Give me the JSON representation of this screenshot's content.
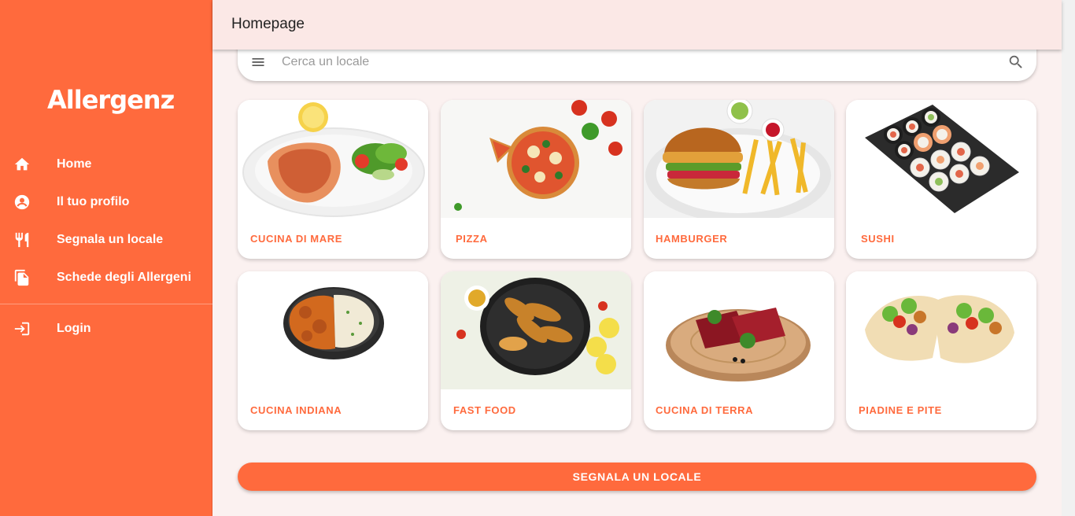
{
  "app": {
    "logo_text": "Allergenz"
  },
  "header": {
    "title": "Homepage"
  },
  "sidebar": {
    "items": [
      {
        "label": "Home",
        "icon": "home-icon"
      },
      {
        "label": "Il tuo profilo",
        "icon": "account-icon"
      },
      {
        "label": "Segnala un locale",
        "icon": "restaurant-icon"
      },
      {
        "label": "Schede degli Allergeni",
        "icon": "file-copy-icon"
      }
    ],
    "login": {
      "label": "Login",
      "icon": "login-icon"
    }
  },
  "search": {
    "placeholder": "Cerca un locale",
    "value": ""
  },
  "categories": [
    {
      "label": "CUCINA DI MARE",
      "image": "salmon-steak-plate"
    },
    {
      "label": "PIZZA",
      "image": "pizza"
    },
    {
      "label": "HAMBURGER",
      "image": "burger-and-fries"
    },
    {
      "label": "SUSHI",
      "image": "sushi-platter"
    },
    {
      "label": "CUCINA INDIANA",
      "image": "curry-and-rice"
    },
    {
      "label": "FAST FOOD",
      "image": "fried-chicken-pan"
    },
    {
      "label": "CUCINA DI TERRA",
      "image": "raw-meat-board"
    },
    {
      "label": "PIADINE E PITE",
      "image": "pita-wraps"
    }
  ],
  "cta": {
    "label": "SEGNALA UN LOCALE"
  },
  "colors": {
    "primary": "#ff6a3d",
    "header_bg": "#fbe8e6",
    "page_bg": "#fbf1f0"
  }
}
